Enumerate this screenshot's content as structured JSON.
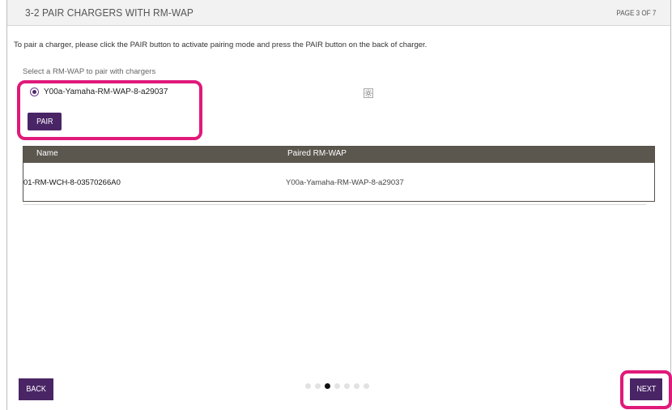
{
  "header": {
    "title": "3-2 PAIR CHARGERS WITH RM-WAP",
    "page_indicator": "PAGE 3 OF 7"
  },
  "instruction": "To pair a charger, please click the PAIR button to activate pairing mode and press the PAIR button on the back of charger.",
  "select_label": "Select a RM-WAP to pair with chargers",
  "rm_wap": {
    "selected_option": "Y00a-Yamaha-RM-WAP-8-a29037",
    "pair_label": "PAIR",
    "status_icon": "sun-icon"
  },
  "table": {
    "columns": [
      "Name",
      "Paired RM-WAP"
    ],
    "rows": [
      {
        "name": "01-RM-WCH-8-03570266A0",
        "paired": "Y00a-Yamaha-RM-WAP-8-a29037"
      }
    ]
  },
  "footer": {
    "back_label": "BACK",
    "next_label": "NEXT",
    "page_count": 7,
    "current_page": 3
  },
  "colors": {
    "button_purple": "#4a2566",
    "highlight_pink": "#e0197a",
    "table_header": "#5b574f"
  }
}
